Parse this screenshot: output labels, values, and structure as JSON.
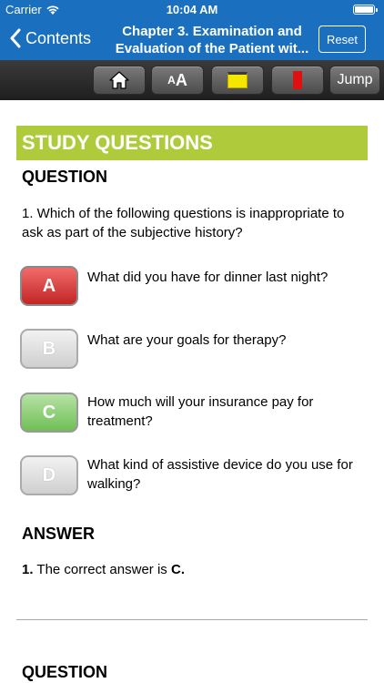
{
  "status_bar": {
    "carrier": "Carrier",
    "time": "10:04 AM"
  },
  "nav": {
    "back_label": "Contents",
    "title_line1": "Chapter 3. Examination and",
    "title_line2": "Evaluation of the Patient wit...",
    "reset_label": "Reset"
  },
  "toolbar": {
    "home_icon": "home-icon",
    "font_small": "A",
    "font_big": "A",
    "note_icon": "note-icon",
    "bookmark_icon": "bookmark-icon",
    "jump_label": "Jump"
  },
  "content": {
    "section_title": "STUDY QUESTIONS",
    "question_heading": "QUESTION",
    "question_text": "1. Which of the following questions is inappropriate to ask as part of the subjective history?",
    "choices": [
      {
        "letter": "A",
        "text": "What did you have for dinner last night?",
        "state": "selected-wrong"
      },
      {
        "letter": "B",
        "text": "What are your goals for therapy?",
        "state": "neutral"
      },
      {
        "letter": "C",
        "text": "How much will your insurance pay for treatment?",
        "state": "correct"
      },
      {
        "letter": "D",
        "text": "What kind of assistive device do you use for walking?",
        "state": "neutral"
      }
    ],
    "answer_heading": "ANSWER",
    "answer_number": "1.",
    "answer_prefix": " The correct answer is ",
    "answer_letter": "C",
    "answer_suffix": ".",
    "next_question_heading": "QUESTION"
  },
  "colors": {
    "header_blue": "#1a6fbf",
    "banner_green": "#afca3b",
    "wrong_red": "#c22525",
    "correct_green": "#6fbf57"
  }
}
